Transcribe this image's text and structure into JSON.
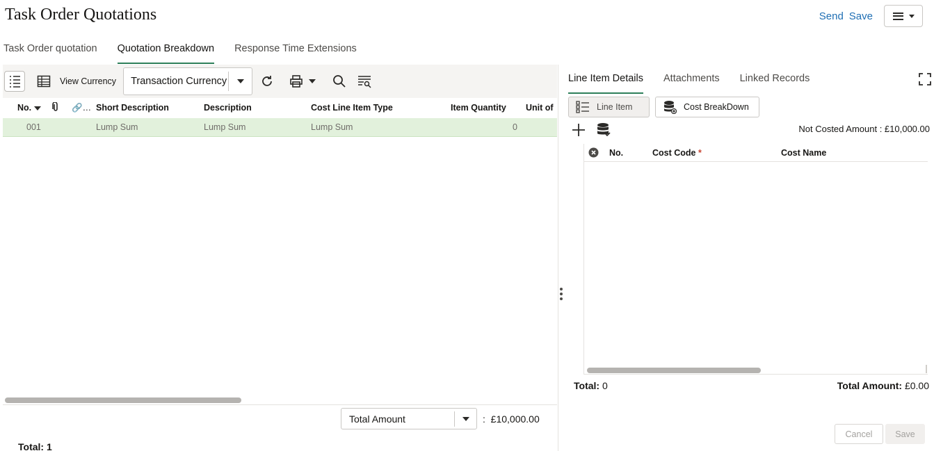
{
  "header": {
    "title": "Task Order Quotations",
    "send_label": "Send",
    "save_label": "Save"
  },
  "tabs": [
    {
      "label": "Task Order quotation",
      "active": false
    },
    {
      "label": "Quotation Breakdown",
      "active": true
    },
    {
      "label": "Response Time Extensions",
      "active": false
    }
  ],
  "toolbar": {
    "view_currency_label": "View Currency",
    "currency_value": "Transaction Currency"
  },
  "grid": {
    "columns": [
      "No.",
      "Short Description",
      "Description",
      "Cost Line Item Type",
      "Item Quantity",
      "Unit of"
    ],
    "rows": [
      {
        "no": "001",
        "short_description": "Lump Sum",
        "description": "Lump Sum",
        "cost_line_item_type": "Lump Sum",
        "item_quantity": "0"
      }
    ]
  },
  "footer": {
    "total_select": "Total Amount",
    "separator": ":",
    "total_amount": "£10,000.00",
    "total_count": "Total: 1"
  },
  "right_panel": {
    "tabs": [
      {
        "label": "Line Item Details",
        "active": true
      },
      {
        "label": "Attachments",
        "active": false
      },
      {
        "label": "Linked Records",
        "active": false
      }
    ],
    "segments": {
      "line_item": "Line Item",
      "cost_breakdown": "Cost BreakDown"
    },
    "not_costed": "Not Costed Amount : £10,000.00",
    "columns": {
      "no": "No.",
      "cost_code": "Cost Code",
      "required_mark": "*",
      "cost_name": "Cost Name"
    },
    "total_label": "Total:",
    "total_value": "0",
    "total_amount_label": "Total Amount:",
    "total_amount_value": "£0.00",
    "cancel_label": "Cancel",
    "save_label": "Save"
  },
  "colors": {
    "accent": "#2d7f59",
    "link": "#1f6fb4",
    "row_highlight": "#e2f1dc"
  }
}
